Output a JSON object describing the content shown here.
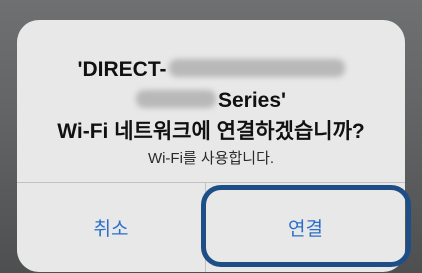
{
  "dialog": {
    "title_line1": "'DIRECT-",
    "title_line2": "Series'",
    "question": "Wi-Fi 네트워크에 연결하겠습니까?",
    "message": "Wi-Fi를 사용합니다.",
    "cancel_label": "취소",
    "connect_label": "연결"
  },
  "colors": {
    "button_text": "#2a6fc9",
    "highlight_ring": "#1d4f86",
    "dialog_background": "#e9e8e8"
  }
}
